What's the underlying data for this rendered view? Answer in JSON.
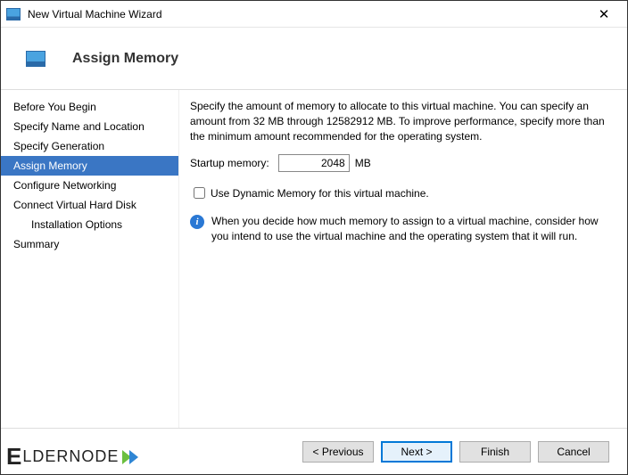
{
  "window": {
    "title": "New Virtual Machine Wizard"
  },
  "header": {
    "title": "Assign Memory"
  },
  "sidebar": {
    "steps": [
      "Before You Begin",
      "Specify Name and Location",
      "Specify Generation",
      "Assign Memory",
      "Configure Networking",
      "Connect Virtual Hard Disk",
      "Installation Options",
      "Summary"
    ],
    "active_index": 3,
    "indent_indices": [
      6
    ]
  },
  "content": {
    "description": "Specify the amount of memory to allocate to this virtual machine. You can specify an amount from 32 MB through 12582912 MB. To improve performance, specify more than the minimum amount recommended for the operating system.",
    "startup_label": "Startup memory:",
    "startup_value": "2048",
    "startup_unit": "MB",
    "dynamic_label": "Use Dynamic Memory for this virtual machine.",
    "info_text": "When you decide how much memory to assign to a virtual machine, consider how you intend to use the virtual machine and the operating system that it will run.",
    "info_glyph": "i"
  },
  "footer": {
    "previous": "< Previous",
    "next": "Next >",
    "finish": "Finish",
    "cancel": "Cancel"
  },
  "watermark": {
    "brand_first": "E",
    "brand_rest": "LDERNODE"
  }
}
